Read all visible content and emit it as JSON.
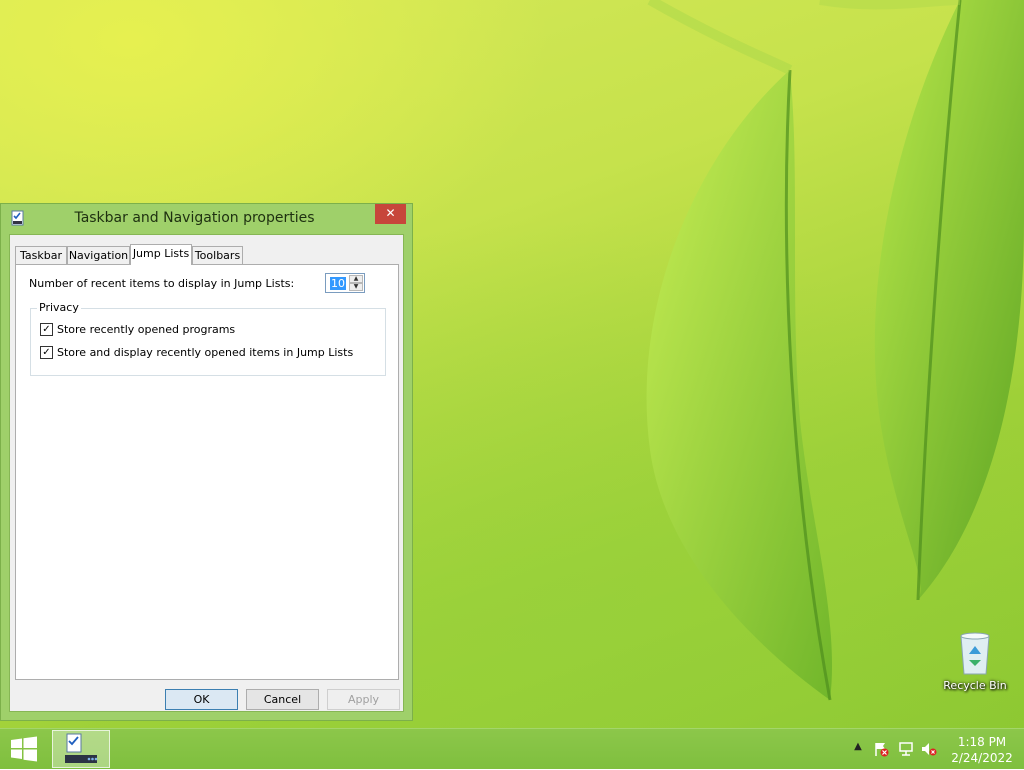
{
  "window": {
    "title": "Taskbar and Navigation properties",
    "close_label": "✕",
    "tabs": [
      {
        "label": "Taskbar"
      },
      {
        "label": "Navigation"
      },
      {
        "label": "Jump Lists"
      },
      {
        "label": "Toolbars"
      }
    ],
    "active_tab": "Jump Lists",
    "jump_list_label": "Number of recent items to display in Jump Lists:",
    "recent_items_value": "10",
    "privacy": {
      "legend": "Privacy",
      "options": [
        {
          "label": "Store recently opened programs",
          "checked": true
        },
        {
          "label": "Store and display recently opened items in Jump Lists",
          "checked": true
        }
      ]
    },
    "buttons": {
      "ok": "OK",
      "cancel": "Cancel",
      "apply": "Apply"
    }
  },
  "desktop": {
    "recycle_bin_label": "Recycle Bin"
  },
  "taskbar": {
    "time": "1:18 PM",
    "date": "2/24/2022",
    "tray_icons": [
      "chevron-up-icon",
      "action-center-flag-icon",
      "network-icon",
      "volume-muted-icon"
    ]
  },
  "colors": {
    "window_frame": "#9fd06a",
    "close_button": "#c7463b",
    "taskbar": "#86c444",
    "selection": "#3399ff"
  }
}
